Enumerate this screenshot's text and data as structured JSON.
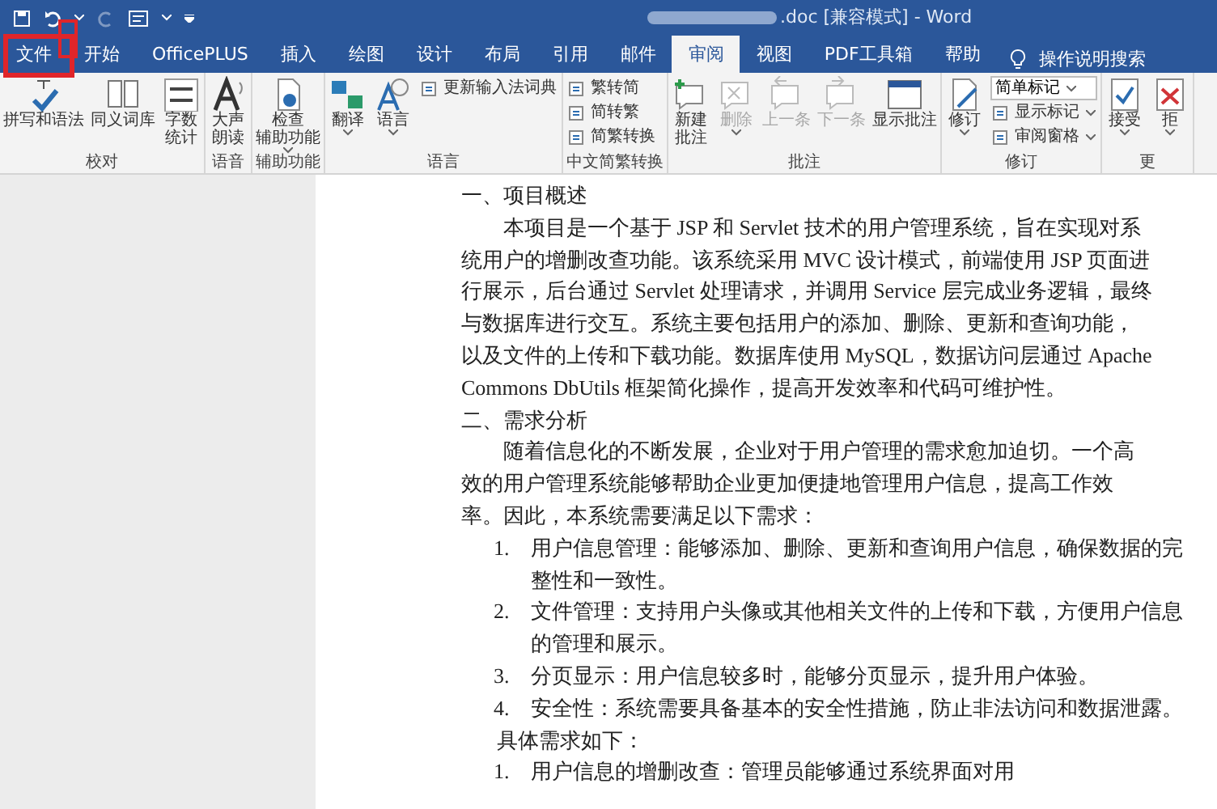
{
  "window": {
    "title": ".doc [兼容模式] - Word"
  },
  "tabs": [
    {
      "label": "文件",
      "selected": false
    },
    {
      "label": "开始",
      "selected": false
    },
    {
      "label": "OfficePLUS",
      "selected": false
    },
    {
      "label": "插入",
      "selected": false
    },
    {
      "label": "绘图",
      "selected": false
    },
    {
      "label": "设计",
      "selected": false
    },
    {
      "label": "布局",
      "selected": false
    },
    {
      "label": "引用",
      "selected": false
    },
    {
      "label": "邮件",
      "selected": false
    },
    {
      "label": "审阅",
      "selected": true
    },
    {
      "label": "视图",
      "selected": false
    },
    {
      "label": "PDF工具箱",
      "selected": false
    },
    {
      "label": "帮助",
      "selected": false
    }
  ],
  "tell_me": {
    "placeholder": "操作说明搜索"
  },
  "ribbon": [
    {
      "label": "校对",
      "buttons": [
        {
          "label": "拼写和语法",
          "kind": "large",
          "disabled": false,
          "caret": false
        },
        {
          "label": "同义词库",
          "kind": "large",
          "disabled": false,
          "caret": false
        },
        {
          "label": [
            "字数",
            "统计"
          ],
          "kind": "large",
          "disabled": false,
          "caret": false
        }
      ]
    },
    {
      "label": "语音",
      "buttons": [
        {
          "label": [
            "大声",
            "朗读"
          ],
          "kind": "large",
          "disabled": false,
          "caret": false
        }
      ]
    },
    {
      "label": "辅助功能",
      "buttons": [
        {
          "label": [
            "检查",
            "辅助功能"
          ],
          "kind": "large",
          "disabled": false,
          "caret": true
        }
      ]
    },
    {
      "label": "语言",
      "buttons": [
        {
          "label": "翻译",
          "kind": "large",
          "disabled": false,
          "caret": true
        },
        {
          "label": "语言",
          "kind": "large",
          "disabled": false,
          "caret": true
        },
        {
          "label": "更新输入法词典",
          "kind": "small",
          "disabled": false,
          "caret": false
        }
      ]
    },
    {
      "label": "中文简繁转换",
      "buttons": [
        {
          "label": "繁转简",
          "kind": "small",
          "disabled": false,
          "caret": false
        },
        {
          "label": "简转繁",
          "kind": "small",
          "disabled": false,
          "caret": false
        },
        {
          "label": "简繁转换",
          "kind": "small",
          "disabled": false,
          "caret": false
        }
      ]
    },
    {
      "label": "批注",
      "buttons": [
        {
          "label": [
            "新建",
            "批注"
          ],
          "kind": "large",
          "disabled": false,
          "caret": false
        },
        {
          "label": "删除",
          "kind": "large",
          "disabled": true,
          "caret": true
        },
        {
          "label": "上一条",
          "kind": "large",
          "disabled": true,
          "caret": false
        },
        {
          "label": "下一条",
          "kind": "large",
          "disabled": true,
          "caret": false
        },
        {
          "label": "显示批注",
          "kind": "large",
          "disabled": false,
          "caret": false
        }
      ]
    },
    {
      "label": "修订",
      "buttons": [
        {
          "label": "修订",
          "kind": "large",
          "disabled": false,
          "caret": true
        },
        {
          "label": "简单标记",
          "kind": "dropdown",
          "disabled": false,
          "caret": true
        },
        {
          "label": "显示标记",
          "kind": "small",
          "disabled": false,
          "caret": true
        },
        {
          "label": "审阅窗格",
          "kind": "small",
          "disabled": false,
          "caret": true
        }
      ]
    },
    {
      "label": "更",
      "buttons": [
        {
          "label": "接受",
          "kind": "large",
          "disabled": false,
          "caret": true
        },
        {
          "label": "拒",
          "kind": "large",
          "disabled": false,
          "caret": true
        }
      ]
    }
  ],
  "document": [
    {
      "kind": "heading",
      "text": "一、项目概述"
    },
    {
      "kind": "paragraph",
      "text": "本项目是一个基于 JSP 和 Servlet 技术的用户管理系统，旨在实现对系统用户的增删改查功能。该系统采用 MVC 设计模式，前端使用 JSP 页面进行展示，后台通过 Servlet 处理请求，并调用 Service 层完成业务逻辑，最终与数据库进行交互。系统主要包括用户的添加、删除、更新和查询功能，以及文件的上传和下载功能。数据库使用 MySQL，数据访问层通过 Apache Commons DbUtils 框架简化操作，提高开发效率和代码可维护性。"
    },
    {
      "kind": "heading",
      "text": "二、需求分析"
    },
    {
      "kind": "paragraph",
      "text": "随着信息化的不断发展，企业对于用户管理的需求愈加迫切。一个高效的用户管理系统能够帮助企业更加便捷地管理用户信息，提高工作效率。因此，本系统需要满足以下需求："
    },
    {
      "kind": "item",
      "number": "1.",
      "text": "用户信息管理：能够添加、删除、更新和查询用户信息，确保数据的完整性和一致性。"
    },
    {
      "kind": "item",
      "number": "2.",
      "text": "文件管理：支持用户头像或其他相关文件的上传和下载，方便用户信息的管理和展示。"
    },
    {
      "kind": "item",
      "number": "3.",
      "text": "分页显示：用户信息较多时，能够分页显示，提升用户体验。"
    },
    {
      "kind": "item",
      "number": "4.",
      "text": "安全性：系统需要具备基本的安全性措施，防止非法访问和数据泄露。"
    },
    {
      "kind": "line",
      "text": "具体需求如下："
    },
    {
      "kind": "item",
      "number": "1.",
      "text": "用户信息的增删改查：管理员能够通过系统界面对用"
    }
  ]
}
